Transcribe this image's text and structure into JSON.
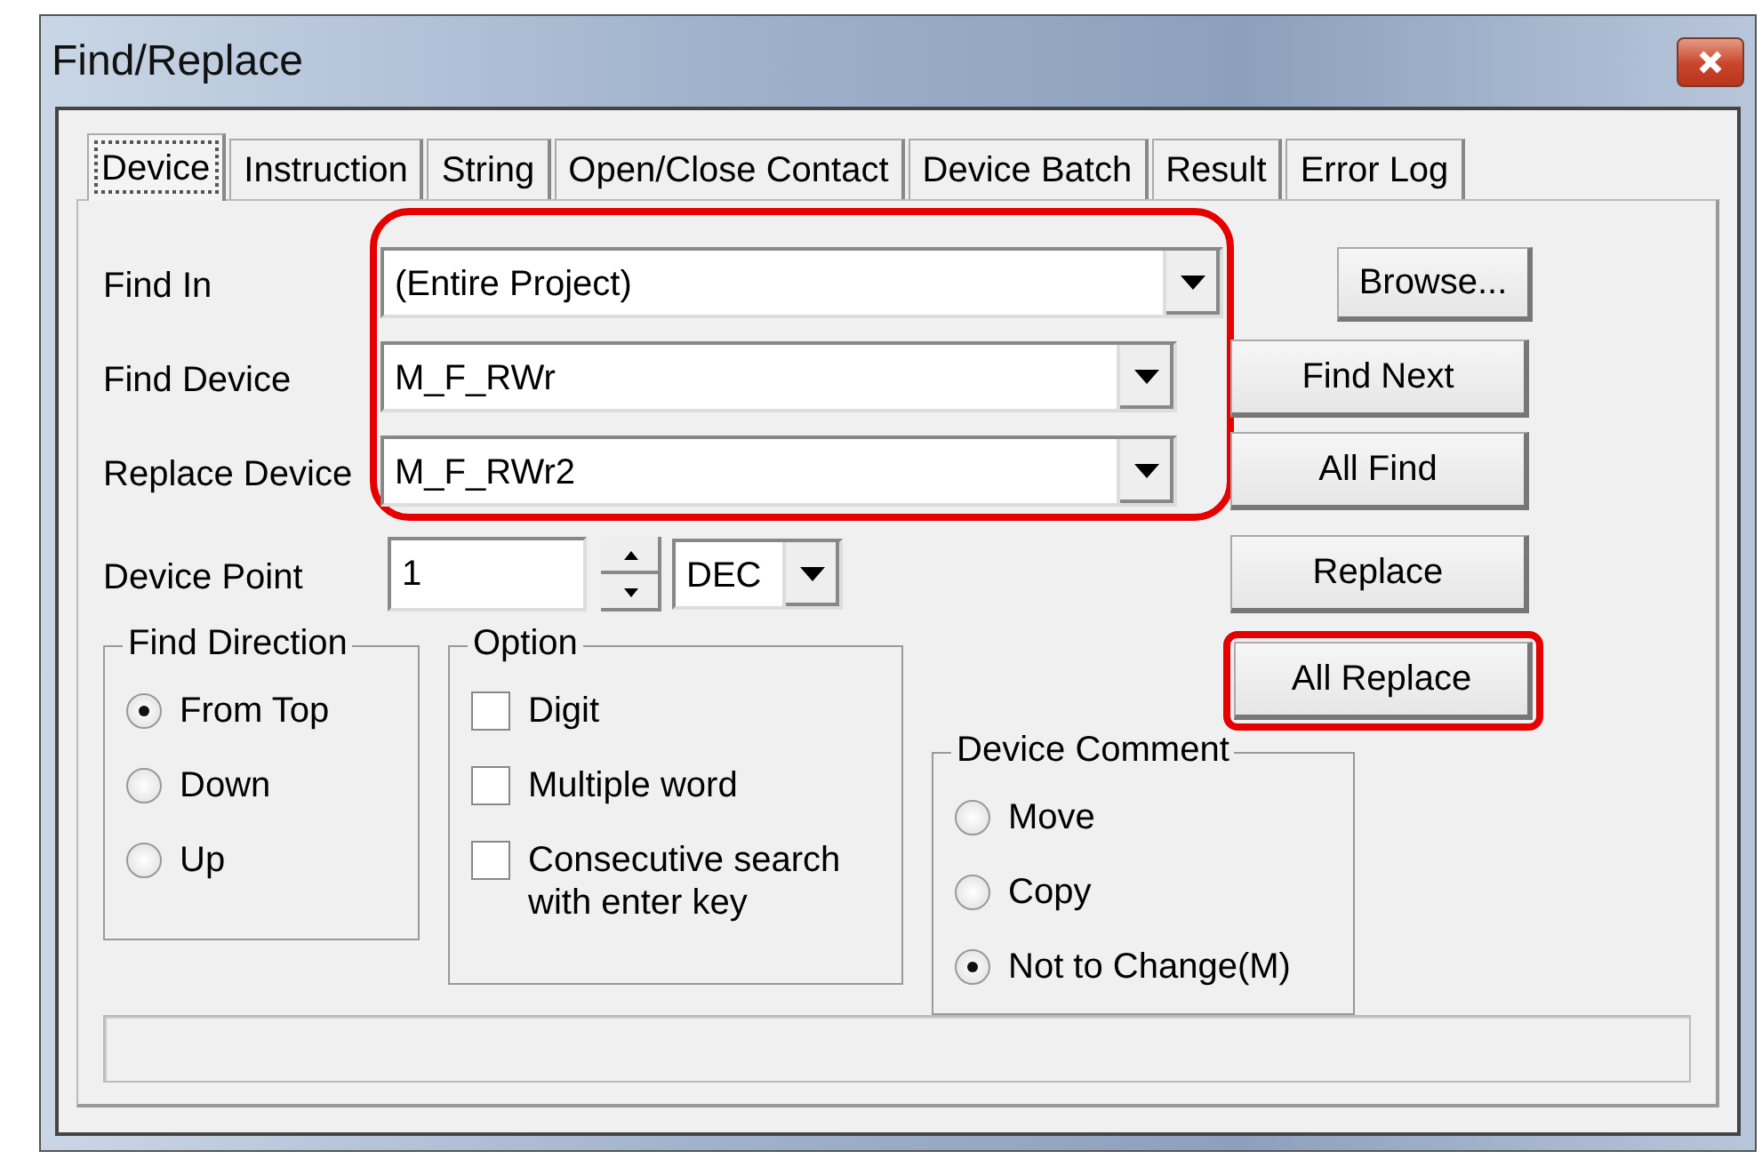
{
  "window": {
    "title": "Find/Replace"
  },
  "tabs": [
    {
      "label": "Device",
      "selected": true
    },
    {
      "label": "Instruction",
      "selected": false
    },
    {
      "label": "String",
      "selected": false
    },
    {
      "label": "Open/Close Contact",
      "selected": false
    },
    {
      "label": "Device Batch",
      "selected": false
    },
    {
      "label": "Result",
      "selected": false
    },
    {
      "label": "Error Log",
      "selected": false
    }
  ],
  "fields_highlighted": true,
  "fields": [
    {
      "label": "Find In",
      "value": "(Entire Project)",
      "kind": "wide"
    },
    {
      "label": "Find Device",
      "value": "M_F_RWr",
      "kind": "normal"
    },
    {
      "label": "Replace Device",
      "value": "M_F_RWr2",
      "kind": "normal"
    }
  ],
  "device_point": {
    "label": "Device Point",
    "value": "1",
    "format": "DEC"
  },
  "buttons": [
    {
      "label": "Browse...",
      "highlighted": false
    },
    {
      "label": "Find Next",
      "highlighted": false
    },
    {
      "label": "All Find",
      "highlighted": false
    },
    {
      "label": "Replace",
      "highlighted": false
    },
    {
      "label": "All Replace",
      "highlighted": true
    }
  ],
  "find_direction": {
    "title": "Find Direction",
    "options": [
      {
        "label": "From Top",
        "selected": true
      },
      {
        "label": "Down",
        "selected": false
      },
      {
        "label": "Up",
        "selected": false
      }
    ]
  },
  "option": {
    "title": "Option",
    "items": [
      {
        "label": "Digit",
        "checked": false
      },
      {
        "label": "Multiple word",
        "checked": false
      },
      {
        "label": "Consecutive search with enter key",
        "checked": false
      }
    ]
  },
  "device_comment": {
    "title": "Device Comment",
    "options": [
      {
        "label": "Move",
        "selected": false
      },
      {
        "label": "Copy",
        "selected": false
      },
      {
        "label": "Not to Change(M)",
        "selected": true
      }
    ]
  }
}
